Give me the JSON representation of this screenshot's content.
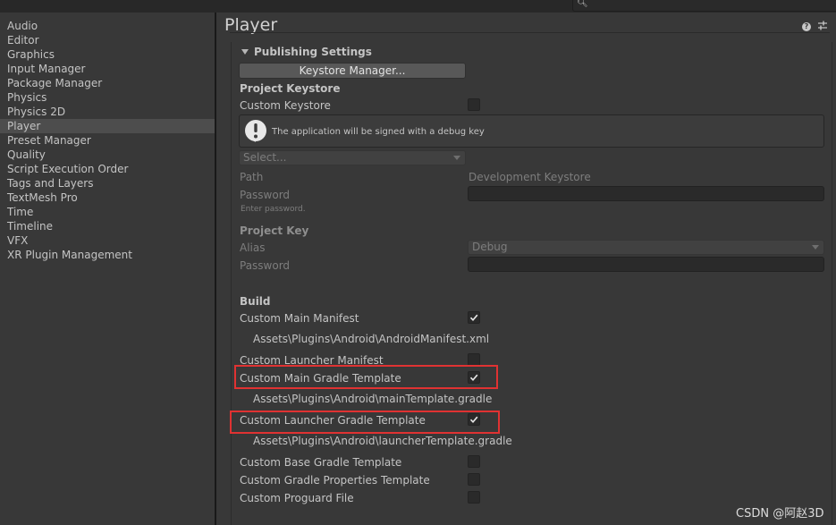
{
  "sidebar": {
    "items": [
      {
        "label": "Audio"
      },
      {
        "label": "Editor"
      },
      {
        "label": "Graphics"
      },
      {
        "label": "Input Manager"
      },
      {
        "label": "Package Manager"
      },
      {
        "label": "Physics"
      },
      {
        "label": "Physics 2D"
      },
      {
        "label": "Player",
        "selected": true
      },
      {
        "label": "Preset Manager"
      },
      {
        "label": "Quality"
      },
      {
        "label": "Script Execution Order"
      },
      {
        "label": "Tags and Layers"
      },
      {
        "label": "TextMesh Pro"
      },
      {
        "label": "Time"
      },
      {
        "label": "Timeline"
      },
      {
        "label": "VFX"
      },
      {
        "label": "XR Plugin Management"
      }
    ]
  },
  "header": {
    "title": "Player",
    "help_icon": "help-icon",
    "settings_icon": "settings-sliders-icon"
  },
  "publishing": {
    "section_title": "Publishing Settings",
    "keystore_manager_button": "Keystore Manager...",
    "project_keystore_header": "Project Keystore",
    "custom_keystore_label": "Custom Keystore",
    "custom_keystore_checked": false,
    "debug_key_message": "The application will be signed with a debug key",
    "keystore_select_value": "Select...",
    "path_label": "Path",
    "path_value": "Development Keystore",
    "password_label": "Password",
    "password_placeholder": "Enter password.",
    "project_key_header": "Project Key",
    "alias_label": "Alias",
    "alias_value": "Debug",
    "key_password_label": "Password"
  },
  "build": {
    "header": "Build",
    "custom_main_manifest": {
      "label": "Custom Main Manifest",
      "checked": true,
      "path": "Assets\\Plugins\\Android\\AndroidManifest.xml"
    },
    "custom_launcher_manifest": {
      "label": "Custom Launcher Manifest",
      "checked": false
    },
    "custom_main_gradle": {
      "label": "Custom Main Gradle Template",
      "checked": true,
      "path": "Assets\\Plugins\\Android\\mainTemplate.gradle"
    },
    "custom_launcher_gradle": {
      "label": "Custom Launcher Gradle Template",
      "checked": true,
      "path": "Assets\\Plugins\\Android\\launcherTemplate.gradle"
    },
    "custom_base_gradle": {
      "label": "Custom Base Gradle Template",
      "checked": false
    },
    "custom_gradle_properties": {
      "label": "Custom Gradle Properties Template",
      "checked": false
    },
    "custom_proguard": {
      "label": "Custom Proguard File",
      "checked": false
    }
  },
  "watermark": "CSDN @阿赵3D",
  "colors": {
    "highlight_box": "#e03232",
    "background": "#383838",
    "sidebar_selected": "#4d4d4d"
  }
}
